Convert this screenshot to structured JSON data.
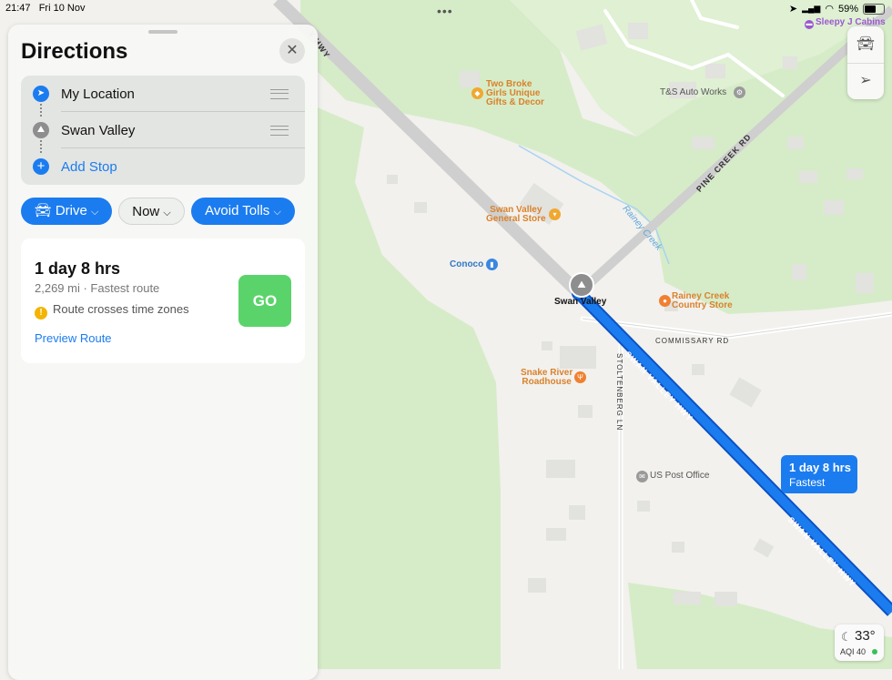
{
  "status_bar": {
    "time": "21:47",
    "date": "Fri 10 Nov",
    "battery": "59%"
  },
  "panel": {
    "title": "Directions",
    "stops": [
      {
        "label": "My Location",
        "icon": "location-arrow-icon"
      },
      {
        "label": "Swan Valley",
        "icon": "place-icon"
      }
    ],
    "add_stop": "Add Stop",
    "chips": {
      "drive": "Drive",
      "time": "Now",
      "avoid": "Avoid Tolls"
    },
    "route": {
      "duration": "1 day 8 hrs",
      "subtitle": "2,269 mi · Fastest route",
      "warning": "Route crosses time zones",
      "preview": "Preview Route",
      "go": "GO"
    }
  },
  "map": {
    "pois": {
      "two_broke": [
        "Two Broke",
        "Girls Unique",
        "Gifts & Decor"
      ],
      "ts_auto": "T&S Auto Works",
      "swan_store": [
        "Swan Valley",
        "General Store"
      ],
      "conoco": "Conoco",
      "swan_valley_pin": "Swan Valley",
      "rainey_store": [
        "Rainey Creek",
        "Country Store"
      ],
      "snake_river": [
        "Snake River",
        "Roadhouse"
      ],
      "post_office": "US Post Office",
      "sleepy": "Sleepy J Cabins"
    },
    "roads": {
      "swan_hwy": "SWAN VALLEY HWY",
      "pine_creek": "PINE CREEK RD",
      "commissary": "COMMISSARY RD",
      "stoltenberg": "STOLTENBERG LN",
      "rainey_creek": "Rainey Creek",
      "hwy_top": "Y HWY"
    },
    "callout": {
      "duration": "1 day 8 hrs",
      "label": "Fastest"
    },
    "weather": {
      "temp": "33°",
      "aqi": "AQI 40"
    }
  },
  "colors": {
    "accent": "#1b7cf0",
    "go": "#5ad46a",
    "route": "#1b7cf0"
  }
}
